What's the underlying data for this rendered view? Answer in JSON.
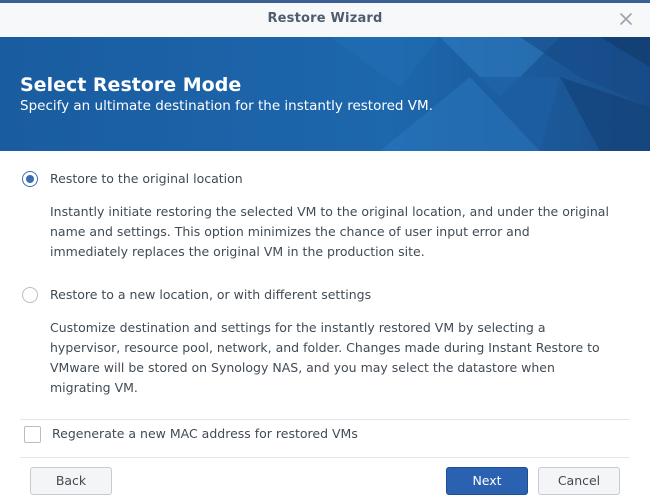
{
  "window": {
    "title": "Restore Wizard"
  },
  "banner": {
    "title": "Select Restore Mode",
    "subtitle": "Specify an ultimate destination for the instantly restored VM."
  },
  "options": [
    {
      "label": "Restore to the original location",
      "selected": true,
      "description": "Instantly initiate restoring the selected VM to the original location, and under the original name and settings. This option minimizes the chance of user input error and immediately replaces the original VM in the production site."
    },
    {
      "label": "Restore to a new location, or with different settings",
      "selected": false,
      "description": "Customize destination and settings for the instantly restored VM by selecting a hypervisor, resource pool, network, and folder. Changes made during Instant Restore to VMware will be stored on Synology NAS, and you may select the datastore when migrating VM."
    }
  ],
  "regenerate_mac": {
    "label": "Regenerate a new MAC address for restored VMs",
    "checked": false
  },
  "buttons": {
    "back": "Back",
    "next": "Next",
    "cancel": "Cancel"
  },
  "icons": {
    "close": "close-icon"
  },
  "colors": {
    "banner": "#1e63a8",
    "primary": "#2a62b1",
    "accent_top": "#3a5f93"
  }
}
